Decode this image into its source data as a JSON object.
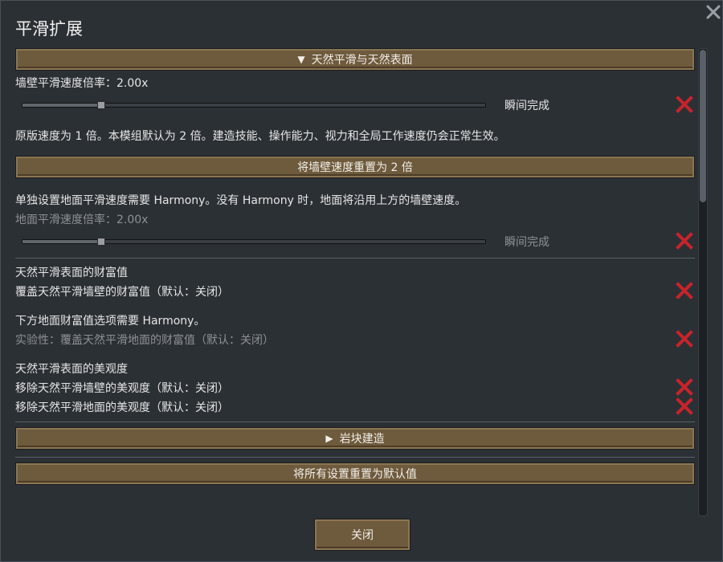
{
  "window": {
    "title": "平滑扩展"
  },
  "sections": {
    "natural": {
      "arrow": "▼",
      "label": "天然平滑与天然表面"
    },
    "rock": {
      "arrow": "▶",
      "label": "岩块建造"
    }
  },
  "wall_speed": {
    "label": "墙壁平滑速度倍率：2.00x",
    "slider_fraction": 0.17,
    "slider_caption": "瞬间完成",
    "note": "原版速度为 1 倍。本模组默认为 2 倍。建造技能、操作能力、视力和全局工作速度仍会正常生效。",
    "reset_label": "将墙壁速度重置为 2 倍"
  },
  "floor_speed": {
    "note": "单独设置地面平滑速度需要 Harmony。没有 Harmony 时，地面将沿用上方的墙壁速度。",
    "label": "地面平滑速度倍率：2.00x",
    "slider_fraction": 0.17,
    "slider_caption": "瞬间完成"
  },
  "wealth": {
    "heading": "天然平滑表面的财富值",
    "override_wall": "覆盖天然平滑墙壁的财富值（默认：关闭）",
    "note": "下方地面财富值选项需要 Harmony。",
    "override_floor": "实验性：覆盖天然平滑地面的财富值（默认：关闭）"
  },
  "beauty": {
    "heading": "天然平滑表面的美观度",
    "remove_wall": "移除天然平滑墙壁的美观度（默认：关闭）",
    "remove_floor": "移除天然平滑地面的美观度（默认：关闭）"
  },
  "reset_all_label": "将所有设置重置为默认值",
  "close_label": "关闭",
  "colors": {
    "toggle_off": "#c8232b",
    "button_face": "#6e5a3c",
    "background": "#2b3035"
  },
  "icons": {
    "window_close": "close-icon",
    "toggle_off": "red-x-icon"
  }
}
